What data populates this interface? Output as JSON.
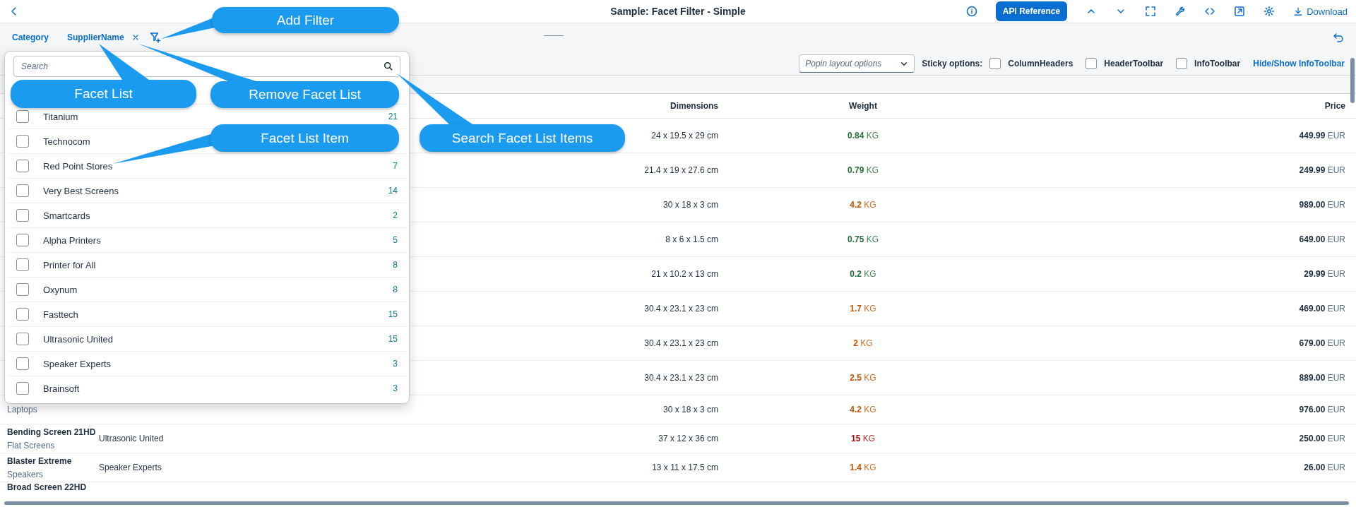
{
  "header": {
    "title": "Sample: Facet Filter - Simple",
    "api_button": "API Reference",
    "download": "Download"
  },
  "facet_filter": {
    "facets": [
      {
        "label": "Category",
        "removable": false
      },
      {
        "label": "SupplierName",
        "removable": true
      }
    ]
  },
  "toolbar": {
    "popin_select": {
      "placeholder": "Popin layout options"
    },
    "sticky_label": "Sticky options:",
    "sticky_options": [
      {
        "label": "ColumnHeaders",
        "checked": false
      },
      {
        "label": "HeaderToolbar",
        "checked": false
      },
      {
        "label": "InfoToolbar",
        "checked": false
      }
    ],
    "link": "Hide/Show InfoToolbar"
  },
  "table": {
    "columns": [
      "Dimensions",
      "Weight",
      "Price"
    ],
    "rows": [
      {
        "dimensions": "24 x 19.5 x 29 cm",
        "weight": {
          "value": "0.84",
          "unit": "KG",
          "color": "#256f3a"
        },
        "price": "449.99",
        "currency": "EUR"
      },
      {
        "dimensions": "21.4 x 19 x 27.6 cm",
        "weight": {
          "value": "0.79",
          "unit": "KG",
          "color": "#256f3a"
        },
        "price": "249.99",
        "currency": "EUR"
      },
      {
        "dimensions": "30 x 18 x 3 cm",
        "weight": {
          "value": "4.2",
          "unit": "KG",
          "color": "#c35500"
        },
        "price": "989.00",
        "currency": "EUR"
      },
      {
        "dimensions": "8 x 6 x 1.5 cm",
        "weight": {
          "value": "0.75",
          "unit": "KG",
          "color": "#256f3a"
        },
        "price": "649.00",
        "currency": "EUR"
      },
      {
        "dimensions": "21 x 10.2 x 13 cm",
        "weight": {
          "value": "0.2",
          "unit": "KG",
          "color": "#256f3a"
        },
        "price": "29.99",
        "currency": "EUR"
      },
      {
        "dimensions": "30.4 x 23.1 x 23 cm",
        "weight": {
          "value": "1.7",
          "unit": "KG",
          "color": "#c35500"
        },
        "price": "469.00",
        "currency": "EUR"
      },
      {
        "dimensions": "30.4 x 23.1 x 23 cm",
        "weight": {
          "value": "2",
          "unit": "KG",
          "color": "#c35500"
        },
        "price": "679.00",
        "currency": "EUR"
      },
      {
        "dimensions": "30.4 x 23.1 x 23 cm",
        "weight": {
          "value": "2.5",
          "unit": "KG",
          "color": "#c35500"
        },
        "price": "889.00",
        "currency": "EUR"
      },
      {
        "category": "Laptops",
        "dimensions": "30 x 18 x 3 cm",
        "weight": {
          "value": "4.2",
          "unit": "KG",
          "color": "#c35500"
        },
        "price": "976.00",
        "currency": "EUR"
      },
      {
        "name": "Bending Screen 21HD",
        "category": "Flat Screens",
        "supplier": "Ultrasonic United",
        "dimensions": "37 x 12 x 36 cm",
        "weight": {
          "value": "15",
          "unit": "KG",
          "color": "#aa0808"
        },
        "price": "250.00",
        "currency": "EUR"
      },
      {
        "name": "Blaster Extreme",
        "category": "Speakers",
        "supplier": "Speaker Experts",
        "dimensions": "13 x 11 x 17.5 cm",
        "weight": {
          "value": "1.4",
          "unit": "KG",
          "color": "#c35500"
        },
        "price": "26.00",
        "currency": "EUR"
      },
      {
        "name": "Broad Screen 22HD"
      }
    ]
  },
  "facet_popover": {
    "search": {
      "placeholder": "Search"
    },
    "items": [
      {
        "label": "Titanium",
        "count": "21",
        "checked": false
      },
      {
        "label": "Technocom",
        "checked": false
      },
      {
        "label": "Red Point Stores",
        "count": "7",
        "checked": false
      },
      {
        "label": "Very Best Screens",
        "count": "14",
        "checked": false
      },
      {
        "label": "Smartcards",
        "count": "2",
        "checked": false
      },
      {
        "label": "Alpha Printers",
        "count": "5",
        "checked": false
      },
      {
        "label": "Printer for All",
        "count": "8",
        "checked": false
      },
      {
        "label": "Oxynum",
        "count": "8",
        "checked": false
      },
      {
        "label": "Fasttech",
        "count": "15",
        "checked": false
      },
      {
        "label": "Ultrasonic United",
        "count": "15",
        "checked": false
      },
      {
        "label": "Speaker Experts",
        "count": "3",
        "checked": false
      },
      {
        "label": "Brainsoft",
        "count": "3",
        "checked": false
      }
    ]
  },
  "annotations": [
    {
      "text": "Add Filter"
    },
    {
      "text": "Facet List"
    },
    {
      "text": "Remove Facet List"
    },
    {
      "text": "Facet List Item"
    },
    {
      "text": "Search Facet List Items"
    }
  ]
}
